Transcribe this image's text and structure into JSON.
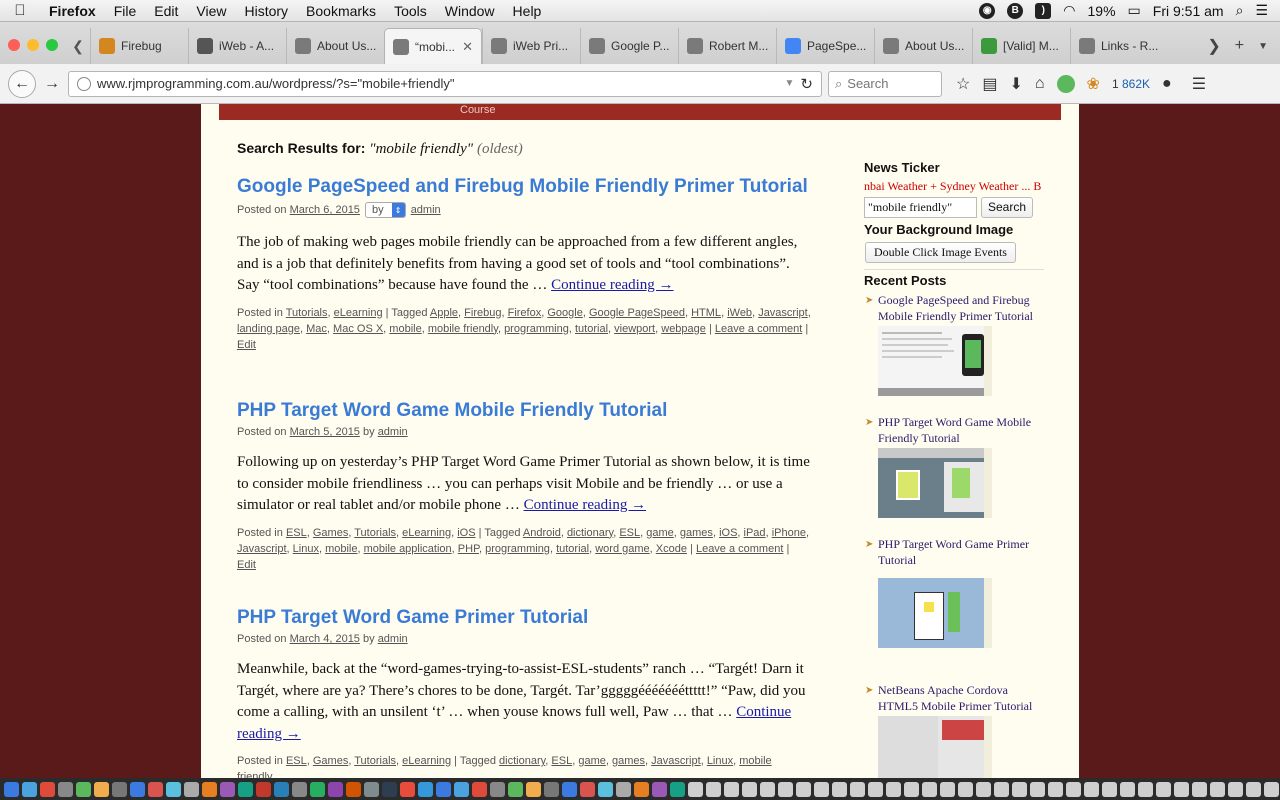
{
  "menubar": {
    "app": "Firefox",
    "items": [
      "File",
      "Edit",
      "View",
      "History",
      "Bookmarks",
      "Tools",
      "Window",
      "Help"
    ],
    "battery": "19%",
    "clock": "Fri 9:51 am"
  },
  "tabs": [
    {
      "label": "Firebug",
      "icon": "firebug-icon",
      "color": "#d4871e"
    },
    {
      "label": "iWeb - A...",
      "icon": "apple-icon",
      "color": "#555555"
    },
    {
      "label": "About Us...",
      "icon": "rjm-icon",
      "color": "#7a7a7a"
    },
    {
      "label": "“mobi...",
      "icon": "rjm-icon",
      "color": "#7a7a7a",
      "active": true
    },
    {
      "label": "iWeb Pri...",
      "icon": "rjm-icon",
      "color": "#7a7a7a"
    },
    {
      "label": "Google P...",
      "icon": "rjm-icon",
      "color": "#7a7a7a"
    },
    {
      "label": "Robert M...",
      "icon": "rjm-icon",
      "color": "#7a7a7a"
    },
    {
      "label": "PageSpe...",
      "icon": "pagespeed-icon",
      "color": "#4285f4"
    },
    {
      "label": "About Us...",
      "icon": "rjm-icon",
      "color": "#7a7a7a"
    },
    {
      "label": "[Valid] M...",
      "icon": "valid-icon",
      "color": "#3c9a3c"
    },
    {
      "label": "Links - R...",
      "icon": "rjm-icon",
      "color": "#7a7a7a"
    }
  ],
  "navbar": {
    "url": "www.rjmprogramming.com.au/wordpress/?s=\"mobile+friendly\"",
    "search_placeholder": "Search",
    "download_count": "1",
    "download_size": "862K"
  },
  "page": {
    "topbar_text": "Course",
    "results_label": "Search Results for:",
    "results_query": "\"mobile friendly\"",
    "results_order": "(oldest)",
    "posts": [
      {
        "title": "Google PageSpeed and Firebug Mobile Friendly Primer Tutorial",
        "posted_on": "Posted on",
        "date": "March 6, 2015",
        "by": "by",
        "author": "admin",
        "excerpt": "The job of making web pages mobile friendly can be approached from a few different angles, and is a job that definitely benefits from having a good set of tools and “tool combinations”. Say “tool combinations” because have found the …",
        "continue": "Continue reading →",
        "posted_in": "Posted in",
        "categories": [
          "Tutorials",
          "eLearning"
        ],
        "tagged": "Tagged",
        "tags": [
          "Apple",
          "Firebug",
          "Firefox",
          "Google",
          "Google PageSpeed",
          "HTML",
          "iWeb",
          "Javascript",
          "landing page",
          "Mac",
          "Mac OS X",
          "mobile",
          "mobile friendly",
          "programming",
          "tutorial",
          "viewport",
          "webpage"
        ],
        "comment": "Leave a comment",
        "edit": "Edit"
      },
      {
        "title": "PHP Target Word Game Mobile Friendly Tutorial",
        "posted_on": "Posted on",
        "date": "March 5, 2015",
        "by": "by",
        "author": "admin",
        "excerpt": "Following up on yesterday’s PHP Target Word Game Primer Tutorial as shown below, it is time to consider mobile friendliness … you can perhaps visit Mobile and be friendly … or use a simulator or real tablet and/or mobile phone …",
        "continue": "Continue reading →",
        "posted_in": "Posted in",
        "categories": [
          "ESL",
          "Games",
          "Tutorials",
          "eLearning",
          "iOS"
        ],
        "tagged": "Tagged",
        "tags": [
          "Android",
          "dictionary",
          "ESL",
          "game",
          "games",
          "iOS",
          "iPad",
          "iPhone",
          "Javascript",
          "Linux",
          "mobile",
          "mobile application",
          "PHP",
          "programming",
          "tutorial",
          "word game",
          "Xcode"
        ],
        "comment": "Leave a comment",
        "edit": "Edit"
      },
      {
        "title": "PHP Target Word Game Primer Tutorial",
        "posted_on": "Posted on",
        "date": "March 4, 2015",
        "by": "by",
        "author": "admin",
        "excerpt": "Meanwhile, back at the “word-games-trying-to-assist-ESL-students” ranch … “Targét! Darn it Targét, where are ya? There’s chores to be done, Targét. Tar’gggggéééééééttttt!” “Paw, did you come a calling, with an unsilent ‘t’ … when youse knows full well, Paw … that …",
        "continue": "Continue reading →",
        "posted_in": "Posted in",
        "categories": [
          "ESL",
          "Games",
          "Tutorials",
          "eLearning"
        ],
        "tagged": "Tagged",
        "tags": [
          "dictionary",
          "ESL",
          "game",
          "games",
          "Javascript",
          "Linux",
          "mobile friendly,"
        ]
      }
    ]
  },
  "sidebar": {
    "ticker_title": "News Ticker",
    "ticker_text": "nbai Weather + Sydney Weather ... B",
    "search_value": "\"mobile friendly\"",
    "search_button": "Search",
    "bg_title": "Your Background Image",
    "bg_button": "Double Click Image Events",
    "recent_title": "Recent Posts",
    "recent": [
      "Google PageSpeed and Firebug Mobile Friendly Primer Tutorial",
      "PHP Target Word Game Mobile Friendly Tutorial",
      "PHP Target Word Game Primer Tutorial",
      "NetBeans Apache Cordova HTML5 Mobile Primer Tutorial"
    ]
  },
  "colors": {
    "link_title": "#3a7bd5",
    "page_bg": "#5a1a1a",
    "content_bg": "#fffdf0",
    "topbar": "#9b2a22"
  }
}
